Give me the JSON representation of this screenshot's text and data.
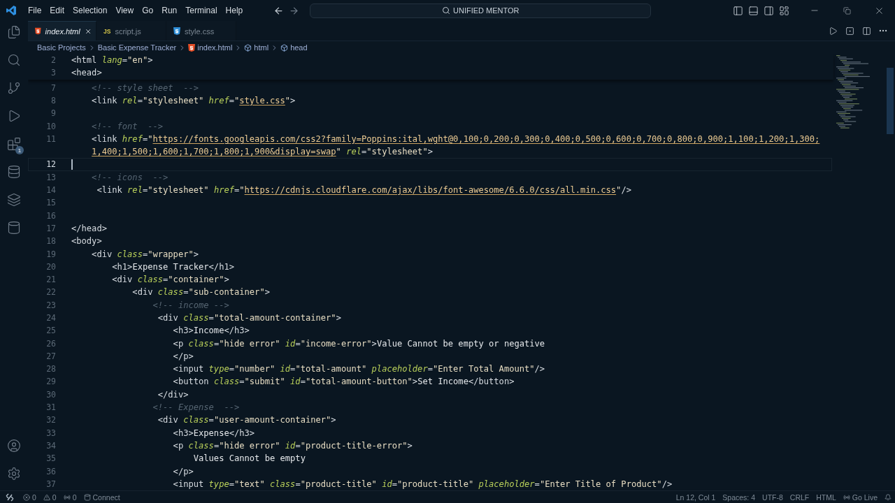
{
  "menu": [
    "File",
    "Edit",
    "Selection",
    "View",
    "Go",
    "Run",
    "Terminal",
    "Help"
  ],
  "search": {
    "text": "UNIFIED MENTOR"
  },
  "activity_bar": {
    "top": [
      {
        "kind": "explorer"
      },
      {
        "kind": "search"
      },
      {
        "kind": "source-control"
      },
      {
        "kind": "run"
      },
      {
        "kind": "extensions",
        "badge": "1"
      },
      {
        "kind": "database"
      },
      {
        "kind": "layers"
      },
      {
        "kind": "storage"
      }
    ],
    "bottom": [
      {
        "kind": "account"
      },
      {
        "kind": "settings"
      }
    ]
  },
  "tabs": [
    {
      "label": "index.html",
      "kind": "html",
      "selected": true,
      "preview": true
    },
    {
      "label": "script.js",
      "kind": "js",
      "icon_label": "JS",
      "selected": false,
      "preview": false
    },
    {
      "label": "style.css",
      "kind": "css",
      "selected": false,
      "preview": false
    }
  ],
  "breadcrumb": [
    {
      "label": "Basic Projects",
      "kind": "folder"
    },
    {
      "label": "Basic Expense Tracker",
      "kind": "folder"
    },
    {
      "label": "index.html",
      "kind": "html"
    },
    {
      "label": "html",
      "kind": "element"
    },
    {
      "label": "head",
      "kind": "element"
    }
  ],
  "sticky_lines": [
    {
      "number": "2",
      "tokens": [
        {
          "kind": "tag",
          "text": "<html "
        },
        {
          "kind": "attr",
          "text": "lang"
        },
        {
          "kind": "tag",
          "text": "="
        },
        {
          "kind": "str",
          "text": "\"en\""
        },
        {
          "kind": "tag",
          "text": ">"
        }
      ]
    },
    {
      "number": "3",
      "tokens": [
        {
          "kind": "tag",
          "text": "<head>"
        }
      ]
    }
  ],
  "lines": [
    {
      "number": "7",
      "current": false,
      "tokens": [
        {
          "kind": "comment",
          "text": "    <!-- style sheet  -->"
        }
      ]
    },
    {
      "number": "8",
      "current": false,
      "tokens": [
        {
          "kind": "tag",
          "text": "    <link "
        },
        {
          "kind": "attr",
          "text": "rel"
        },
        {
          "kind": "tag",
          "text": "="
        },
        {
          "kind": "str",
          "text": "\"stylesheet\" "
        },
        {
          "kind": "attr",
          "text": "href"
        },
        {
          "kind": "tag",
          "text": "="
        },
        {
          "kind": "str",
          "text": "\""
        },
        {
          "kind": "link",
          "text": "style.css"
        },
        {
          "kind": "str",
          "text": "\""
        },
        {
          "kind": "tag",
          "text": ">"
        }
      ]
    },
    {
      "number": "9",
      "current": false
    },
    {
      "number": "10",
      "current": false,
      "tokens": [
        {
          "kind": "comment",
          "text": "    <!-- font  -->"
        }
      ]
    },
    {
      "number": "11",
      "current": false,
      "tokens": [
        {
          "kind": "tag",
          "text": "    <link "
        },
        {
          "kind": "attr",
          "text": "href"
        },
        {
          "kind": "tag",
          "text": "="
        },
        {
          "kind": "str",
          "text": "\""
        },
        {
          "kind": "link",
          "text": "https://fonts.googleapis.com/css2?family=Poppins:ital,wght@0,100;0,200;0,300;0,400;0,500;0,600;0,700;0,800;0,900;1,100;1,200;1,300;"
        }
      ],
      "wrap": [
        {
          "kind": "link",
          "text": "1,400;1,500;1,600;1,700;1,800;1,900&display=swap"
        },
        {
          "kind": "str",
          "text": "\" "
        },
        {
          "kind": "attr",
          "text": "rel"
        },
        {
          "kind": "tag",
          "text": "="
        },
        {
          "kind": "str",
          "text": "\"stylesheet\""
        },
        {
          "kind": "tag",
          "text": ">"
        }
      ]
    },
    {
      "number": "12",
      "current": true
    },
    {
      "number": "13",
      "current": false,
      "tokens": [
        {
          "kind": "comment",
          "text": "    <!-- icons  -->"
        }
      ]
    },
    {
      "number": "14",
      "current": false,
      "tokens": [
        {
          "kind": "tag",
          "text": "     <link "
        },
        {
          "kind": "attr",
          "text": "rel"
        },
        {
          "kind": "tag",
          "text": "="
        },
        {
          "kind": "str",
          "text": "\"stylesheet\" "
        },
        {
          "kind": "attr",
          "text": "href"
        },
        {
          "kind": "tag",
          "text": "="
        },
        {
          "kind": "str",
          "text": "\""
        },
        {
          "kind": "link",
          "text": "https://cdnjs.cloudflare.com/ajax/libs/font-awesome/6.6.0/css/all.min.css"
        },
        {
          "kind": "str",
          "text": "\""
        },
        {
          "kind": "tag",
          "text": "/>"
        }
      ]
    },
    {
      "number": "15",
      "current": false
    },
    {
      "number": "16",
      "current": false
    },
    {
      "number": "17",
      "current": false,
      "tokens": [
        {
          "kind": "tag",
          "text": "</head>"
        }
      ]
    },
    {
      "number": "18",
      "current": false,
      "tokens": [
        {
          "kind": "tag",
          "text": "<body>"
        }
      ]
    },
    {
      "number": "19",
      "current": false,
      "tokens": [
        {
          "kind": "tag",
          "text": "    <div "
        },
        {
          "kind": "attr",
          "text": "class"
        },
        {
          "kind": "tag",
          "text": "="
        },
        {
          "kind": "str",
          "text": "\"wrapper\""
        },
        {
          "kind": "tag",
          "text": ">"
        }
      ]
    },
    {
      "number": "20",
      "current": false,
      "tokens": [
        {
          "kind": "tag",
          "text": "        <h1>"
        },
        {
          "kind": "text",
          "text": "Expense Tracker"
        },
        {
          "kind": "tag",
          "text": "</h1>"
        }
      ]
    },
    {
      "number": "21",
      "current": false,
      "tokens": [
        {
          "kind": "tag",
          "text": "        <div "
        },
        {
          "kind": "attr",
          "text": "class"
        },
        {
          "kind": "tag",
          "text": "="
        },
        {
          "kind": "str",
          "text": "\"container\""
        },
        {
          "kind": "tag",
          "text": ">"
        }
      ]
    },
    {
      "number": "22",
      "current": false,
      "tokens": [
        {
          "kind": "tag",
          "text": "            <div "
        },
        {
          "kind": "attr",
          "text": "class"
        },
        {
          "kind": "tag",
          "text": "="
        },
        {
          "kind": "str",
          "text": "\"sub-container\""
        },
        {
          "kind": "tag",
          "text": ">"
        }
      ]
    },
    {
      "number": "23",
      "current": false,
      "tokens": [
        {
          "kind": "comment",
          "text": "                <!-- income -->"
        }
      ]
    },
    {
      "number": "24",
      "current": false,
      "tokens": [
        {
          "kind": "tag",
          "text": "                 <div "
        },
        {
          "kind": "attr",
          "text": "class"
        },
        {
          "kind": "tag",
          "text": "="
        },
        {
          "kind": "str",
          "text": "\"total-amount-container\""
        },
        {
          "kind": "tag",
          "text": ">"
        }
      ]
    },
    {
      "number": "25",
      "current": false,
      "tokens": [
        {
          "kind": "tag",
          "text": "                    <h3>"
        },
        {
          "kind": "text",
          "text": "Income"
        },
        {
          "kind": "tag",
          "text": "</h3>"
        }
      ]
    },
    {
      "number": "26",
      "current": false,
      "tokens": [
        {
          "kind": "tag",
          "text": "                    <p "
        },
        {
          "kind": "attr",
          "text": "class"
        },
        {
          "kind": "tag",
          "text": "="
        },
        {
          "kind": "str",
          "text": "\"hide error\" "
        },
        {
          "kind": "attr",
          "text": "id"
        },
        {
          "kind": "tag",
          "text": "="
        },
        {
          "kind": "str",
          "text": "\"income-error\""
        },
        {
          "kind": "tag",
          "text": ">"
        },
        {
          "kind": "text",
          "text": "Value Cannot be empty or negative"
        }
      ]
    },
    {
      "number": "27",
      "current": false,
      "tokens": [
        {
          "kind": "tag",
          "text": "                    </p>"
        }
      ]
    },
    {
      "number": "28",
      "current": false,
      "tokens": [
        {
          "kind": "tag",
          "text": "                    <input "
        },
        {
          "kind": "attr",
          "text": "type"
        },
        {
          "kind": "tag",
          "text": "="
        },
        {
          "kind": "str",
          "text": "\"number\" "
        },
        {
          "kind": "attr",
          "text": "id"
        },
        {
          "kind": "tag",
          "text": "="
        },
        {
          "kind": "str",
          "text": "\"total-amount\" "
        },
        {
          "kind": "attr",
          "text": "placeholder"
        },
        {
          "kind": "tag",
          "text": "="
        },
        {
          "kind": "str",
          "text": "\"Enter Total Amount\""
        },
        {
          "kind": "tag",
          "text": "/>"
        }
      ]
    },
    {
      "number": "29",
      "current": false,
      "tokens": [
        {
          "kind": "tag",
          "text": "                    <button "
        },
        {
          "kind": "attr",
          "text": "class"
        },
        {
          "kind": "tag",
          "text": "="
        },
        {
          "kind": "str",
          "text": "\"submit\" "
        },
        {
          "kind": "attr",
          "text": "id"
        },
        {
          "kind": "tag",
          "text": "="
        },
        {
          "kind": "str",
          "text": "\"total-amount-button\""
        },
        {
          "kind": "tag",
          "text": ">"
        },
        {
          "kind": "text",
          "text": "Set Income"
        },
        {
          "kind": "tag",
          "text": "</button>"
        }
      ]
    },
    {
      "number": "30",
      "current": false,
      "tokens": [
        {
          "kind": "tag",
          "text": "                 </div>"
        }
      ]
    },
    {
      "number": "31",
      "current": false,
      "tokens": [
        {
          "kind": "comment",
          "text": "                <!-- Expense  -->"
        }
      ]
    },
    {
      "number": "32",
      "current": false,
      "tokens": [
        {
          "kind": "tag",
          "text": "                 <div "
        },
        {
          "kind": "attr",
          "text": "class"
        },
        {
          "kind": "tag",
          "text": "="
        },
        {
          "kind": "str",
          "text": "\"user-amount-container\""
        },
        {
          "kind": "tag",
          "text": ">"
        }
      ]
    },
    {
      "number": "33",
      "current": false,
      "tokens": [
        {
          "kind": "tag",
          "text": "                    <h3>"
        },
        {
          "kind": "text",
          "text": "Expense"
        },
        {
          "kind": "tag",
          "text": "</h3>"
        }
      ]
    },
    {
      "number": "34",
      "current": false,
      "tokens": [
        {
          "kind": "tag",
          "text": "                    <p "
        },
        {
          "kind": "attr",
          "text": "class"
        },
        {
          "kind": "tag",
          "text": "="
        },
        {
          "kind": "str",
          "text": "\"hide error\" "
        },
        {
          "kind": "attr",
          "text": "id"
        },
        {
          "kind": "tag",
          "text": "="
        },
        {
          "kind": "str",
          "text": "\"product-title-error\""
        },
        {
          "kind": "tag",
          "text": ">"
        }
      ]
    },
    {
      "number": "35",
      "current": false,
      "tokens": [
        {
          "kind": "text",
          "text": "                        Values Cannot be empty"
        }
      ]
    },
    {
      "number": "36",
      "current": false,
      "tokens": [
        {
          "kind": "tag",
          "text": "                    </p>"
        }
      ]
    },
    {
      "number": "37",
      "current": false,
      "tokens": [
        {
          "kind": "tag",
          "text": "                    <input "
        },
        {
          "kind": "attr",
          "text": "type"
        },
        {
          "kind": "tag",
          "text": "="
        },
        {
          "kind": "str",
          "text": "\"text\" "
        },
        {
          "kind": "attr",
          "text": "class"
        },
        {
          "kind": "tag",
          "text": "="
        },
        {
          "kind": "str",
          "text": "\"product-title\" "
        },
        {
          "kind": "attr",
          "text": "id"
        },
        {
          "kind": "tag",
          "text": "="
        },
        {
          "kind": "str",
          "text": "\"product-title\" "
        },
        {
          "kind": "attr",
          "text": "placeholder"
        },
        {
          "kind": "tag",
          "text": "="
        },
        {
          "kind": "str",
          "text": "\"Enter Title of Product\""
        },
        {
          "kind": "tag",
          "text": "/>"
        }
      ]
    }
  ],
  "status_bar": {
    "left": [
      {
        "kind": "remote"
      },
      {
        "kind": "errors",
        "text": "0"
      },
      {
        "kind": "warnings",
        "text": "0"
      },
      {
        "kind": "ports",
        "text": "0"
      },
      {
        "kind": "connect",
        "text": "Connect"
      }
    ],
    "right": [
      {
        "kind": "text",
        "text": "Ln 12, Col 1"
      },
      {
        "kind": "text",
        "text": "Spaces: 4"
      },
      {
        "kind": "text",
        "text": "UTF-8"
      },
      {
        "kind": "text",
        "text": "CRLF"
      },
      {
        "kind": "text",
        "text": "HTML"
      },
      {
        "kind": "golive",
        "text": "Go Live"
      },
      {
        "kind": "bell"
      }
    ]
  }
}
